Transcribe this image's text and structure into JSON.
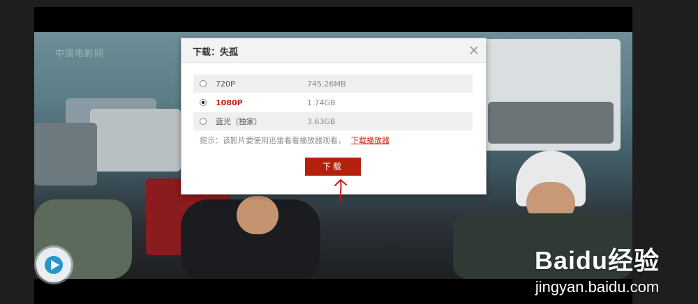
{
  "dialog": {
    "title": "下载：失孤",
    "close_icon": "close-icon",
    "options": [
      {
        "label": "720P",
        "size": "745.26MB",
        "selected": false
      },
      {
        "label": "1080P",
        "size": "1.74GB",
        "selected": true
      },
      {
        "label": "蓝光（独家）",
        "size": "3.63GB",
        "selected": false
      }
    ],
    "tip_text": "提示：该影片要使用迅雷看看播放器观看，",
    "tip_link": "下载播放器",
    "download_label": "下载"
  },
  "video": {
    "watermark": "中国电影网",
    "player_icon": "play-logo-icon"
  },
  "baidu": {
    "logo": "Baidu经验",
    "domain": "jingyan.baidu.com"
  },
  "colors": {
    "accent_red": "#c8220e",
    "button_red": "#b5200c",
    "annotation_red": "#e01010"
  }
}
